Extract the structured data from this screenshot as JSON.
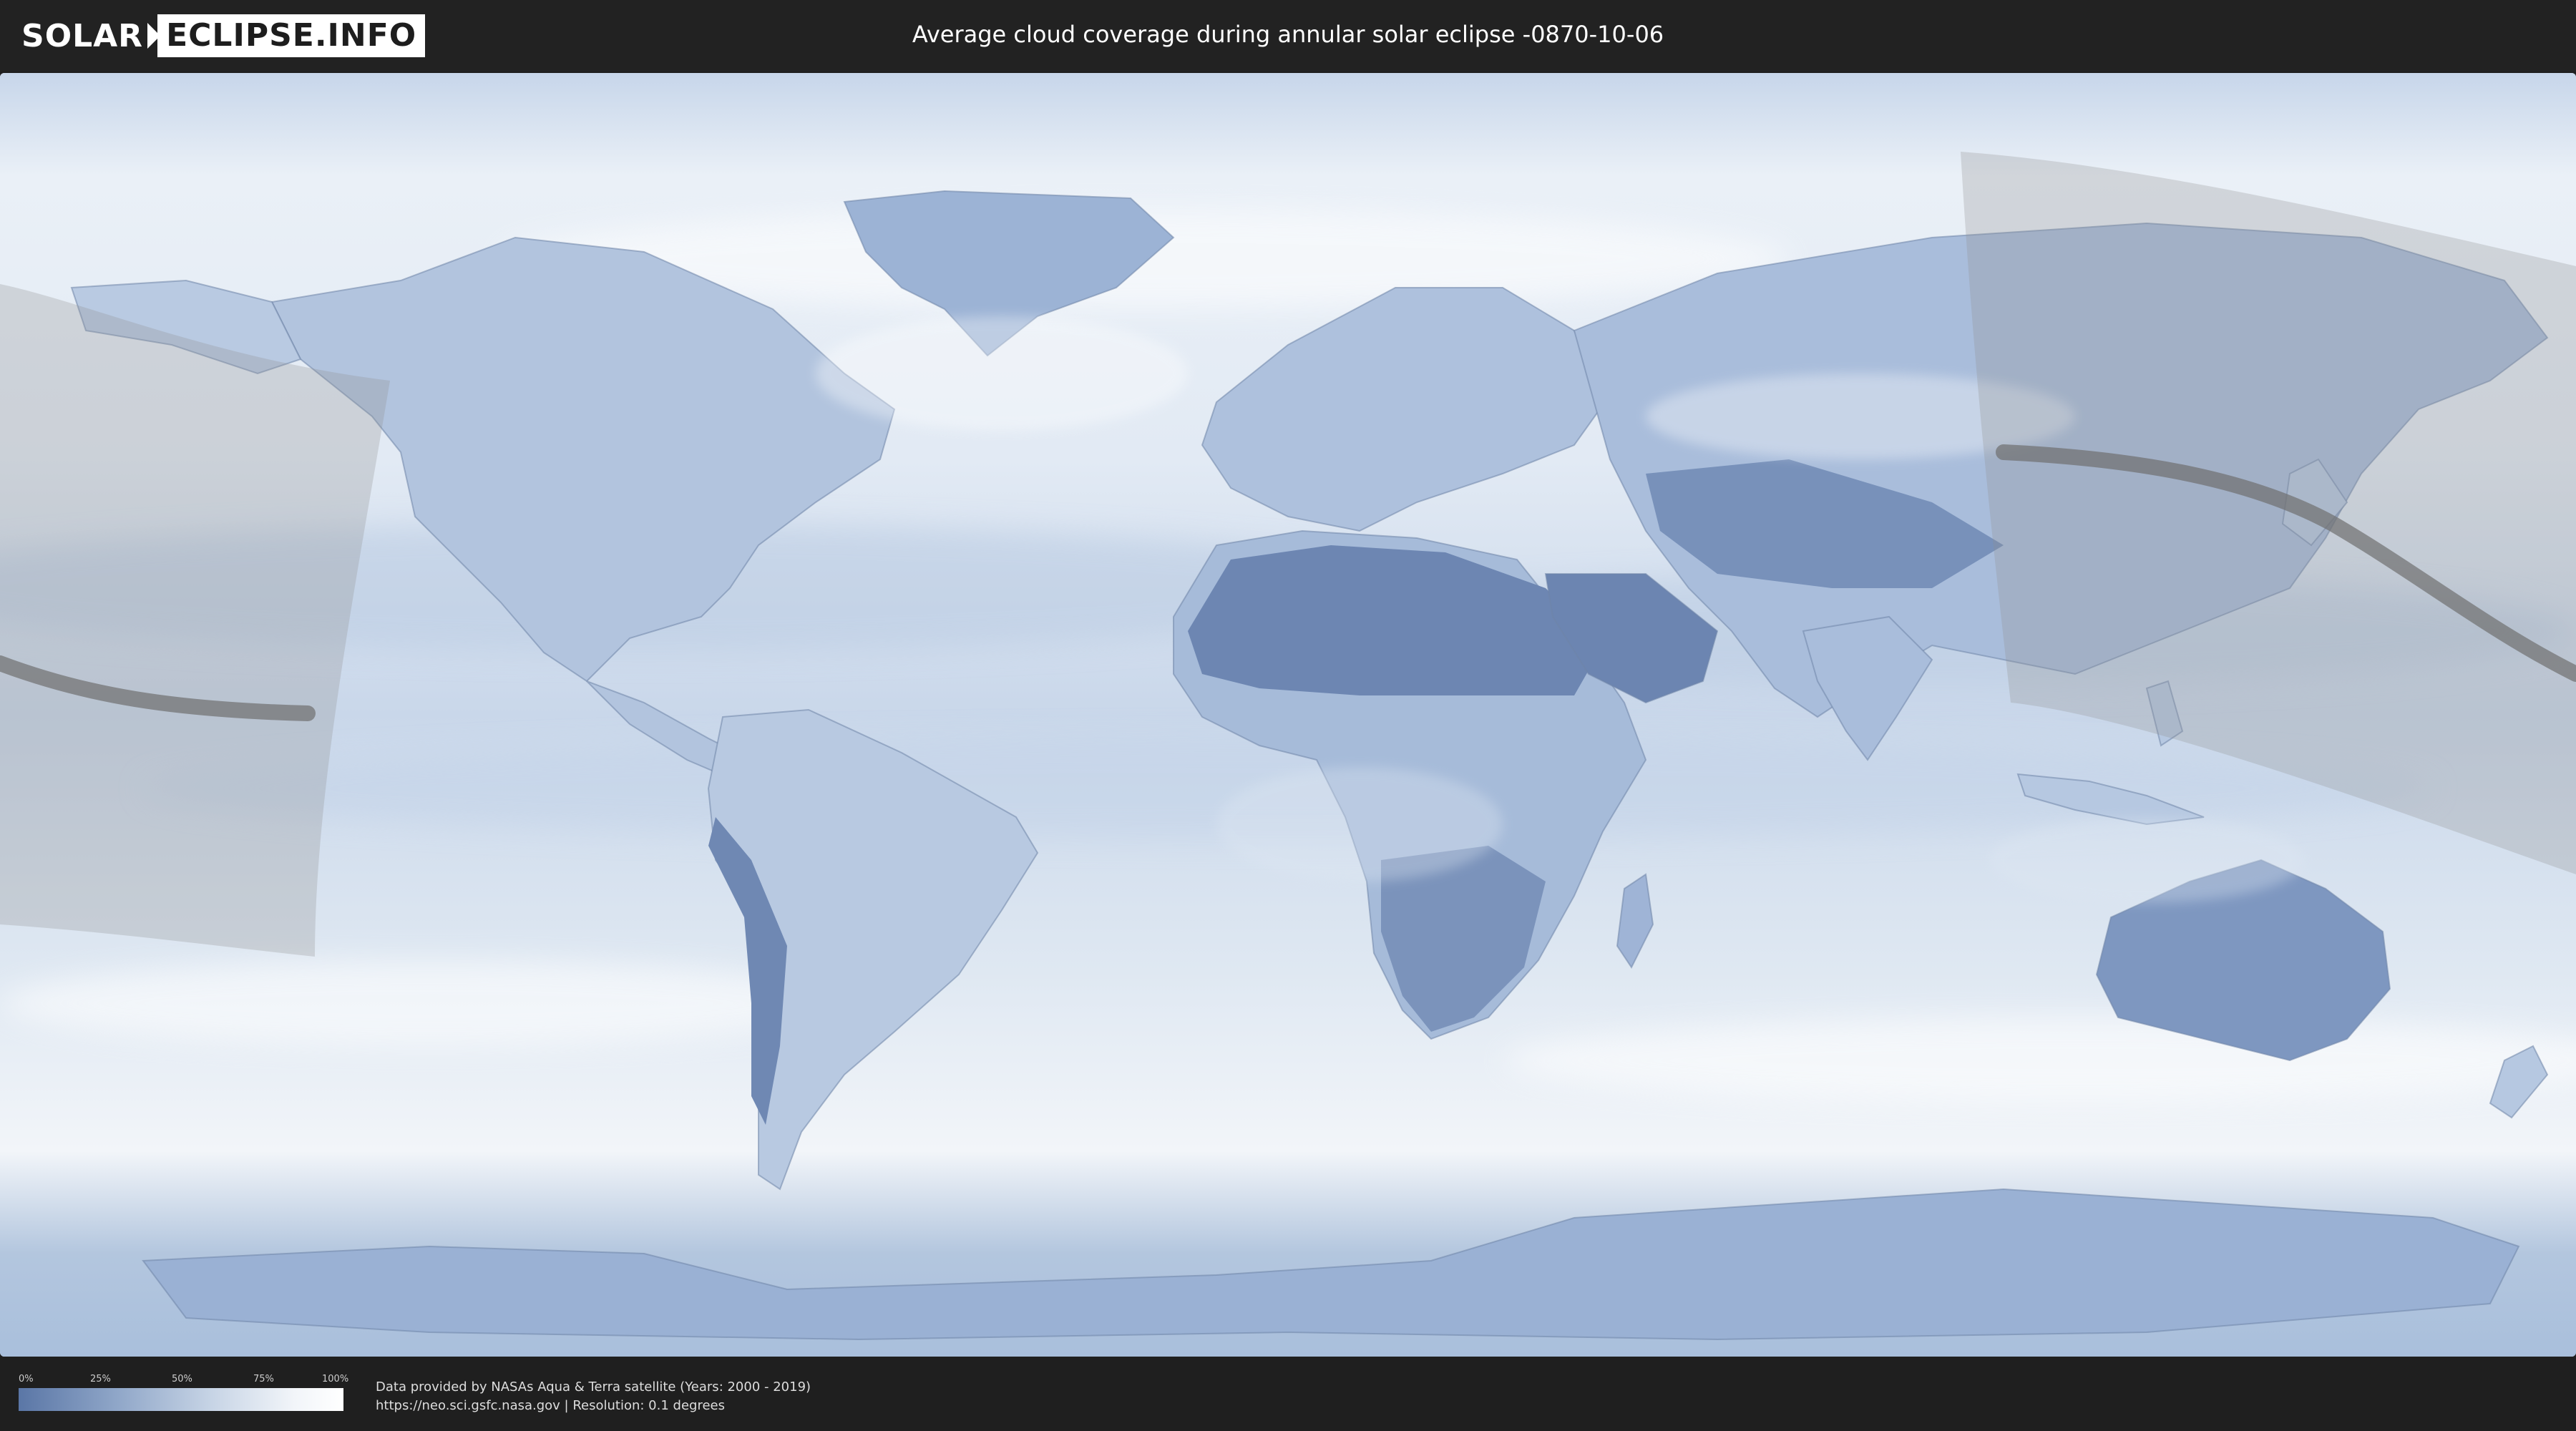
{
  "header": {
    "logo_solar": "SOLAR",
    "logo_eclipse": "ECLIPSE.INFO",
    "title": "Average cloud coverage during annular solar eclipse -0870-10-06"
  },
  "legend": {
    "stops": [
      "0%",
      "25%",
      "50%",
      "75%",
      "100%"
    ],
    "colors": [
      "#5a76a6",
      "#8fa6c8",
      "#c8d5e6",
      "#f2f5f9",
      "#ffffff"
    ]
  },
  "credits": {
    "line1": "Data provided by NASAs Aqua & Terra satellite (Years: 2000 - 2019)",
    "line2": "https://neo.sci.gsfc.nasa.gov | Resolution: 0.1 degrees"
  },
  "map": {
    "ocean_color": "#d7e3f0",
    "land_cloud_color": "#7f98c2",
    "eclipse_band_color": "#9a9a9a"
  }
}
